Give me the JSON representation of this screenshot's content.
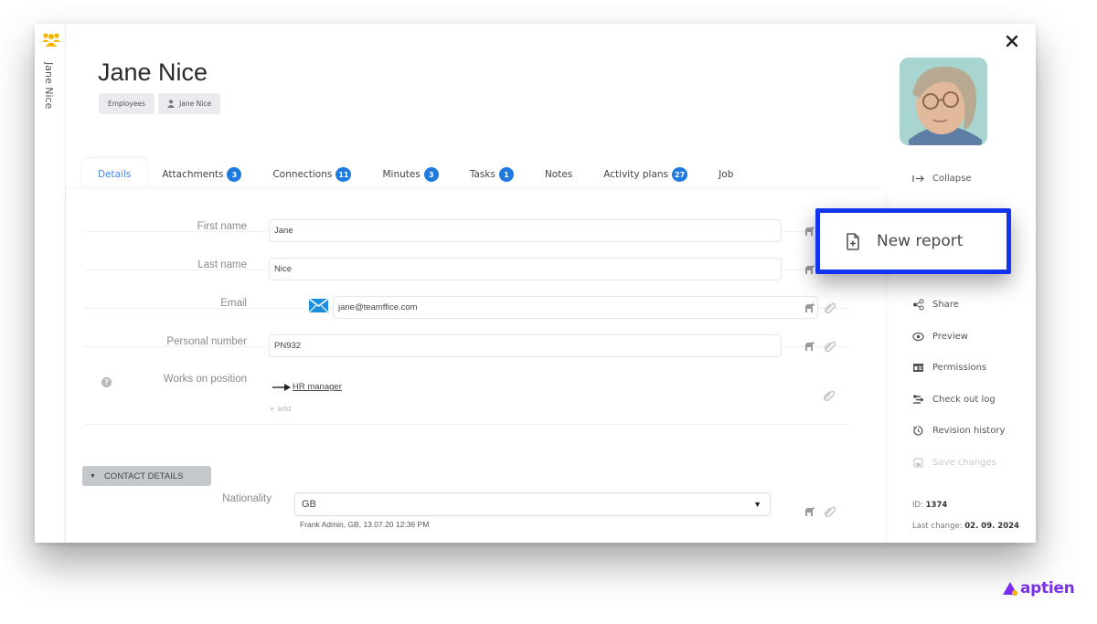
{
  "sidebar_strip": {
    "title": "Jane Nice",
    "icon": "people-group-icon",
    "icon_color": "#f2b600"
  },
  "header": {
    "title": "Jane Nice",
    "breadcrumbs": [
      {
        "label": "Employees",
        "icon": null
      },
      {
        "label": "Jane Nice",
        "icon": "person-icon"
      }
    ]
  },
  "tabs": [
    {
      "label": "Details",
      "badge": null,
      "active": true
    },
    {
      "label": "Attachments",
      "badge": "3"
    },
    {
      "label": "Connections",
      "badge": "11"
    },
    {
      "label": "Minutes",
      "badge": "3"
    },
    {
      "label": "Tasks",
      "badge": "1"
    },
    {
      "label": "Notes",
      "badge": null
    },
    {
      "label": "Activity plans",
      "badge": "27"
    },
    {
      "label": "Job",
      "badge": null
    }
  ],
  "form": {
    "first_name": {
      "label": "First name",
      "value": "Jane"
    },
    "last_name": {
      "label": "Last name",
      "value": "Nice"
    },
    "email": {
      "label": "Email",
      "value": "jane@teamffice.com"
    },
    "personal_number": {
      "label": "Personal number",
      "value": "PN932"
    },
    "works_on_position": {
      "label": "Works on position",
      "value": "HR manager",
      "add_label": "+ add",
      "help": "?"
    }
  },
  "contact_details": {
    "section_label": "CONTACT DETAILS",
    "nationality": {
      "label": "Nationality",
      "value": "GB",
      "note": "Frank Admin, GB, 13.07.20 12:36 PM"
    }
  },
  "actions": [
    {
      "label": "Collapse",
      "icon": "collapse-arrow-icon"
    },
    {
      "label": "Share",
      "icon": "share-icon"
    },
    {
      "label": "Preview",
      "icon": "eye-icon"
    },
    {
      "label": "Permissions",
      "icon": "id-card-icon"
    },
    {
      "label": "Check out log",
      "icon": "checkout-log-icon"
    },
    {
      "label": "Revision history",
      "icon": "history-icon"
    },
    {
      "label": "Save changes",
      "icon": "save-icon",
      "disabled": true
    }
  ],
  "meta": {
    "id_label": "ID:",
    "id_value": "1374",
    "last_change_label": "Last change:",
    "last_change_value": "02. 09. 2024"
  },
  "popup": {
    "label": "New report",
    "icon": "new-report-icon",
    "highlight_color": "#1233f0"
  },
  "brand": {
    "name": "aptien",
    "color": "#7a2ff0"
  }
}
